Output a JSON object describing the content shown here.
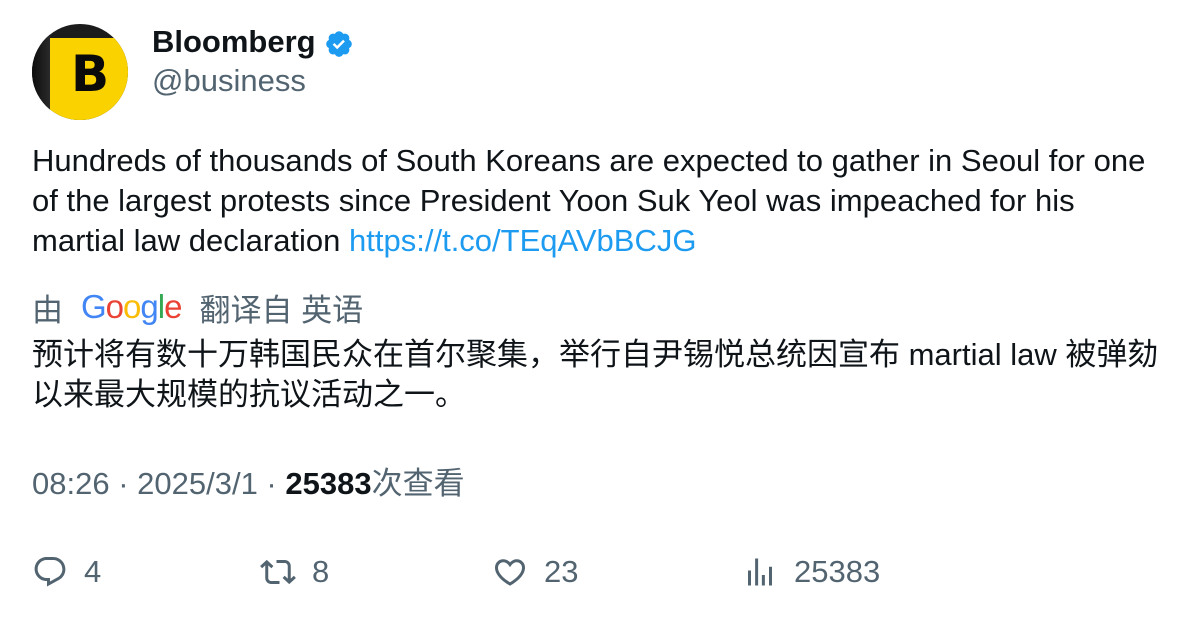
{
  "author": {
    "display_name": "Bloomberg",
    "handle": "@business",
    "avatar_letter": "B",
    "verified": true,
    "verified_color": "#1d9bf0",
    "brand_color": "#f9d200"
  },
  "tweet": {
    "text": "Hundreds of thousands of South Koreans are expected to gather in Seoul for one of the largest protests since President Yoon Suk Yeol was impeached for his martial law declaration ",
    "link": "https://t.co/TEqAVbBCJG",
    "link_color": "#1d9bf0"
  },
  "translation": {
    "prefix": "由",
    "provider_letters": [
      "G",
      "o",
      "o",
      "g",
      "l",
      "e"
    ],
    "label": "翻译自 英语",
    "text": "预计将有数十万韩国民众在首尔聚集，举行自尹锡悦总统因宣布 martial law 被弹劾以来最大规模的抗议活动之一。"
  },
  "meta": {
    "time": "08:26",
    "separator": " · ",
    "date": "2025/3/1",
    "views": "25383",
    "views_label": "次查看"
  },
  "actions": {
    "replies": "4",
    "retweets": "8",
    "likes": "23",
    "views": "25383",
    "icons": [
      "reply-icon",
      "retweet-icon",
      "like-icon",
      "analytics-icon"
    ]
  }
}
